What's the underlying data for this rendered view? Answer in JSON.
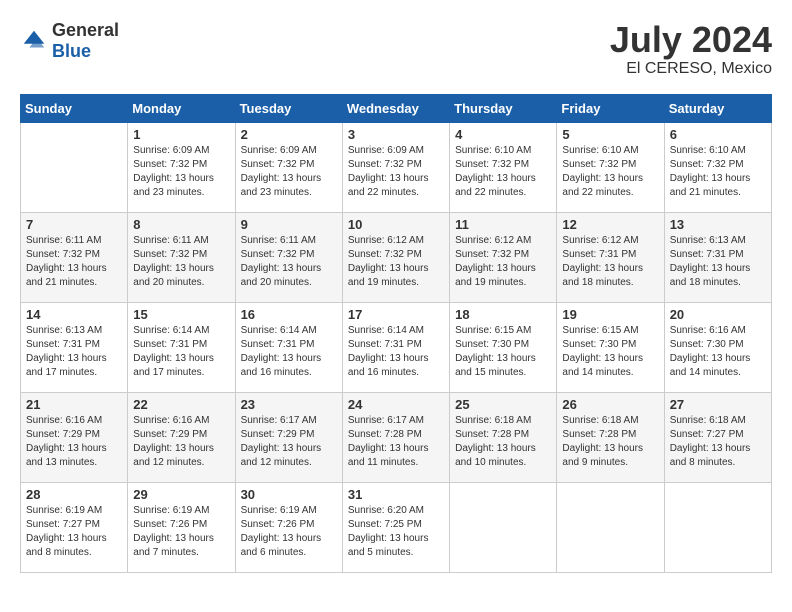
{
  "header": {
    "logo": {
      "text_general": "General",
      "text_blue": "Blue"
    },
    "title": "July 2024",
    "location": "El CERESO, Mexico"
  },
  "calendar": {
    "weekdays": [
      "Sunday",
      "Monday",
      "Tuesday",
      "Wednesday",
      "Thursday",
      "Friday",
      "Saturday"
    ],
    "weeks": [
      [
        {
          "day": null,
          "sunrise": null,
          "sunset": null,
          "daylight": null
        },
        {
          "day": "1",
          "sunrise": "Sunrise: 6:09 AM",
          "sunset": "Sunset: 7:32 PM",
          "daylight": "Daylight: 13 hours and 23 minutes."
        },
        {
          "day": "2",
          "sunrise": "Sunrise: 6:09 AM",
          "sunset": "Sunset: 7:32 PM",
          "daylight": "Daylight: 13 hours and 23 minutes."
        },
        {
          "day": "3",
          "sunrise": "Sunrise: 6:09 AM",
          "sunset": "Sunset: 7:32 PM",
          "daylight": "Daylight: 13 hours and 22 minutes."
        },
        {
          "day": "4",
          "sunrise": "Sunrise: 6:10 AM",
          "sunset": "Sunset: 7:32 PM",
          "daylight": "Daylight: 13 hours and 22 minutes."
        },
        {
          "day": "5",
          "sunrise": "Sunrise: 6:10 AM",
          "sunset": "Sunset: 7:32 PM",
          "daylight": "Daylight: 13 hours and 22 minutes."
        },
        {
          "day": "6",
          "sunrise": "Sunrise: 6:10 AM",
          "sunset": "Sunset: 7:32 PM",
          "daylight": "Daylight: 13 hours and 21 minutes."
        }
      ],
      [
        {
          "day": "7",
          "sunrise": "Sunrise: 6:11 AM",
          "sunset": "Sunset: 7:32 PM",
          "daylight": "Daylight: 13 hours and 21 minutes."
        },
        {
          "day": "8",
          "sunrise": "Sunrise: 6:11 AM",
          "sunset": "Sunset: 7:32 PM",
          "daylight": "Daylight: 13 hours and 20 minutes."
        },
        {
          "day": "9",
          "sunrise": "Sunrise: 6:11 AM",
          "sunset": "Sunset: 7:32 PM",
          "daylight": "Daylight: 13 hours and 20 minutes."
        },
        {
          "day": "10",
          "sunrise": "Sunrise: 6:12 AM",
          "sunset": "Sunset: 7:32 PM",
          "daylight": "Daylight: 13 hours and 19 minutes."
        },
        {
          "day": "11",
          "sunrise": "Sunrise: 6:12 AM",
          "sunset": "Sunset: 7:32 PM",
          "daylight": "Daylight: 13 hours and 19 minutes."
        },
        {
          "day": "12",
          "sunrise": "Sunrise: 6:12 AM",
          "sunset": "Sunset: 7:31 PM",
          "daylight": "Daylight: 13 hours and 18 minutes."
        },
        {
          "day": "13",
          "sunrise": "Sunrise: 6:13 AM",
          "sunset": "Sunset: 7:31 PM",
          "daylight": "Daylight: 13 hours and 18 minutes."
        }
      ],
      [
        {
          "day": "14",
          "sunrise": "Sunrise: 6:13 AM",
          "sunset": "Sunset: 7:31 PM",
          "daylight": "Daylight: 13 hours and 17 minutes."
        },
        {
          "day": "15",
          "sunrise": "Sunrise: 6:14 AM",
          "sunset": "Sunset: 7:31 PM",
          "daylight": "Daylight: 13 hours and 17 minutes."
        },
        {
          "day": "16",
          "sunrise": "Sunrise: 6:14 AM",
          "sunset": "Sunset: 7:31 PM",
          "daylight": "Daylight: 13 hours and 16 minutes."
        },
        {
          "day": "17",
          "sunrise": "Sunrise: 6:14 AM",
          "sunset": "Sunset: 7:31 PM",
          "daylight": "Daylight: 13 hours and 16 minutes."
        },
        {
          "day": "18",
          "sunrise": "Sunrise: 6:15 AM",
          "sunset": "Sunset: 7:30 PM",
          "daylight": "Daylight: 13 hours and 15 minutes."
        },
        {
          "day": "19",
          "sunrise": "Sunrise: 6:15 AM",
          "sunset": "Sunset: 7:30 PM",
          "daylight": "Daylight: 13 hours and 14 minutes."
        },
        {
          "day": "20",
          "sunrise": "Sunrise: 6:16 AM",
          "sunset": "Sunset: 7:30 PM",
          "daylight": "Daylight: 13 hours and 14 minutes."
        }
      ],
      [
        {
          "day": "21",
          "sunrise": "Sunrise: 6:16 AM",
          "sunset": "Sunset: 7:29 PM",
          "daylight": "Daylight: 13 hours and 13 minutes."
        },
        {
          "day": "22",
          "sunrise": "Sunrise: 6:16 AM",
          "sunset": "Sunset: 7:29 PM",
          "daylight": "Daylight: 13 hours and 12 minutes."
        },
        {
          "day": "23",
          "sunrise": "Sunrise: 6:17 AM",
          "sunset": "Sunset: 7:29 PM",
          "daylight": "Daylight: 13 hours and 12 minutes."
        },
        {
          "day": "24",
          "sunrise": "Sunrise: 6:17 AM",
          "sunset": "Sunset: 7:28 PM",
          "daylight": "Daylight: 13 hours and 11 minutes."
        },
        {
          "day": "25",
          "sunrise": "Sunrise: 6:18 AM",
          "sunset": "Sunset: 7:28 PM",
          "daylight": "Daylight: 13 hours and 10 minutes."
        },
        {
          "day": "26",
          "sunrise": "Sunrise: 6:18 AM",
          "sunset": "Sunset: 7:28 PM",
          "daylight": "Daylight: 13 hours and 9 minutes."
        },
        {
          "day": "27",
          "sunrise": "Sunrise: 6:18 AM",
          "sunset": "Sunset: 7:27 PM",
          "daylight": "Daylight: 13 hours and 8 minutes."
        }
      ],
      [
        {
          "day": "28",
          "sunrise": "Sunrise: 6:19 AM",
          "sunset": "Sunset: 7:27 PM",
          "daylight": "Daylight: 13 hours and 8 minutes."
        },
        {
          "day": "29",
          "sunrise": "Sunrise: 6:19 AM",
          "sunset": "Sunset: 7:26 PM",
          "daylight": "Daylight: 13 hours and 7 minutes."
        },
        {
          "day": "30",
          "sunrise": "Sunrise: 6:19 AM",
          "sunset": "Sunset: 7:26 PM",
          "daylight": "Daylight: 13 hours and 6 minutes."
        },
        {
          "day": "31",
          "sunrise": "Sunrise: 6:20 AM",
          "sunset": "Sunset: 7:25 PM",
          "daylight": "Daylight: 13 hours and 5 minutes."
        },
        {
          "day": null,
          "sunrise": null,
          "sunset": null,
          "daylight": null
        },
        {
          "day": null,
          "sunrise": null,
          "sunset": null,
          "daylight": null
        },
        {
          "day": null,
          "sunrise": null,
          "sunset": null,
          "daylight": null
        }
      ]
    ]
  }
}
